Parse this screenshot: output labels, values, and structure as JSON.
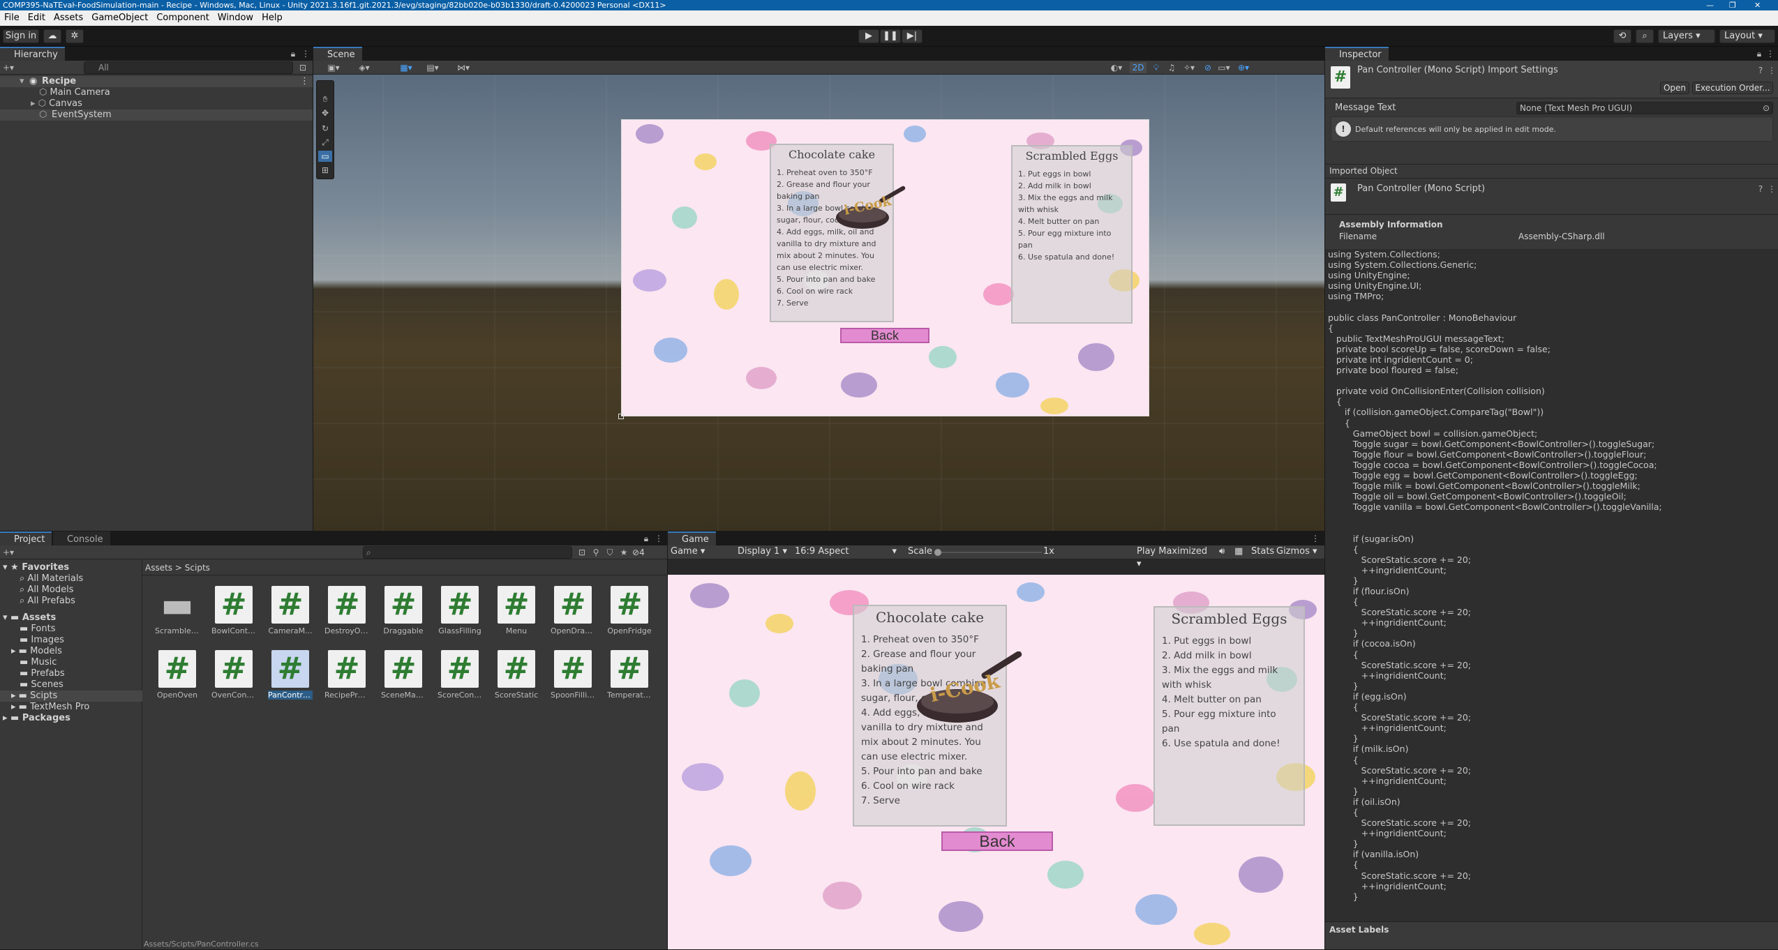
{
  "window": {
    "title": "COMP395-NaTEvaŀ-FoodSimulation-main - Recipe - Windows, Mac, Linux - Unity 2021.3.16f1.git.2021.3/evg/staging/82bb020e-b03b1330/draft-0.4200023 Personal <DX11>"
  },
  "menu": [
    "File",
    "Edit",
    "Assets",
    "GameObject",
    "Component",
    "Window",
    "Help"
  ],
  "toolbar": {
    "signin": "Sign in",
    "layers": "Layers",
    "layout": "Layout"
  },
  "hierarchy": {
    "tab": "Hierarchy",
    "search_placeholder": "All",
    "scene": "Recipe",
    "items": [
      "Main Camera",
      "Canvas",
      "EventSystem"
    ]
  },
  "scene": {
    "tab": "Scene",
    "mode2d": "2D"
  },
  "inspector": {
    "tab": "Inspector",
    "header_title": "Pan Controller (Mono Script) Import Settings",
    "open": "Open",
    "exec_order": "Execution Order...",
    "message_label": "Message Text",
    "message_value": "None (Text Mesh Pro UGUI)",
    "info": "Default references will only be applied in edit mode.",
    "imported_label": "Imported Object",
    "imported_title": "Pan Controller (Mono Script)",
    "assembly_heading": "Assembly Information",
    "filename_label": "Filename",
    "filename_value": "Assembly-CSharp.dll",
    "asset_labels": "Asset Labels"
  },
  "code": "using System.Collections;\nusing System.Collections.Generic;\nusing UnityEngine;\nusing UnityEngine.UI;\nusing TMPro;\n\npublic class PanController : MonoBehaviour\n{\n   public TextMeshProUGUI messageText;\n   private bool scoreUp = false, scoreDown = false;\n   private int ingridientCount = 0;\n   private bool floured = false;\n\n   private void OnCollisionEnter(Collision collision)\n   {\n      if (collision.gameObject.CompareTag(\"Bowl\"))\n      {\n         GameObject bowl = collision.gameObject;\n         Toggle sugar = bowl.GetComponent<BowlController>().toggleSugar;\n         Toggle flour = bowl.GetComponent<BowlController>().toggleFlour;\n         Toggle cocoa = bowl.GetComponent<BowlController>().toggleCocoa;\n         Toggle egg = bowl.GetComponent<BowlController>().toggleEgg;\n         Toggle milk = bowl.GetComponent<BowlController>().toggleMilk;\n         Toggle oil = bowl.GetComponent<BowlController>().toggleOil;\n         Toggle vanilla = bowl.GetComponent<BowlController>().toggleVanilla;\n\n\n         if (sugar.isOn)\n         {\n            ScoreStatic.score += 20;\n            ++ingridientCount;\n         }\n         if (flour.isOn)\n         {\n            ScoreStatic.score += 20;\n            ++ingridientCount;\n         }\n         if (cocoa.isOn)\n         {\n            ScoreStatic.score += 20;\n            ++ingridientCount;\n         }\n         if (egg.isOn)\n         {\n            ScoreStatic.score += 20;\n            ++ingridientCount;\n         }\n         if (milk.isOn)\n         {\n            ScoreStatic.score += 20;\n            ++ingridientCount;\n         }\n         if (oil.isOn)\n         {\n            ScoreStatic.score += 20;\n            ++ingridientCount;\n         }\n         if (vanilla.isOn)\n         {\n            ScoreStatic.score += 20;\n            ++ingridientCount;\n         }",
  "project": {
    "tab": "Project",
    "console_tab": "Console",
    "count": "4",
    "breadcrumb_root": "Assets",
    "breadcrumb_sep": ">",
    "breadcrumb_current": "Scipts",
    "favorites": "Favorites",
    "fav_items": [
      "All Materials",
      "All Models",
      "All Prefabs"
    ],
    "assets_label": "Assets",
    "folders": [
      "Fonts",
      "Images",
      "Models",
      "Music",
      "Prefabs",
      "Scenes",
      "Scipts",
      "TextMesh Pro"
    ],
    "packages": "Packages",
    "files_row1": [
      "Scrambled...",
      "BowlContro...",
      "CameraM...",
      "DestroyOb...",
      "Draggable",
      "GlassFilling",
      "Menu",
      "OpenDraw...",
      "OpenFridge"
    ],
    "files_row2": [
      "OpenOven",
      "OvenCont...",
      "PanControl...",
      "RecipeProg...",
      "SceneMan...",
      "ScoreCont...",
      "ScoreStatic",
      "SpoonFilling",
      "Temperatu..."
    ]
  },
  "game": {
    "tab": "Game",
    "display": "Game",
    "display1": "Display 1",
    "aspect": "16:9 Aspect",
    "scale_label": "Scale",
    "scale_value": "1x",
    "play_mode": "Play Maximized",
    "stats": "Stats",
    "gizmos": "Gizmos"
  },
  "recipe": {
    "cake_title": "Chocolate cake",
    "cake_steps": [
      "1. Preheat oven to 350°F",
      "2. Grease and flour your baking pan",
      "3. In a large bowl combine sugar, flour, cocoa, soda.",
      "4. Add eggs, milk, oil and vanilla to dry mixture and mix about 2 minutes. You can use electric mixer.",
      "5. Pour into pan and bake",
      "6. Cool on wire rack",
      "7. Serve"
    ],
    "eggs_title": "Scrambled Eggs",
    "eggs_steps": [
      "1. Put eggs in bowl",
      "2. Add milk in bowl",
      "3. Mix the eggs and milk with whisk",
      "4. Melt butter on pan",
      "5. Pour egg mixture into pan",
      "6. Use spatula and done!"
    ],
    "logo": "i-Cook",
    "back": "Back"
  },
  "status": {
    "path": "Assets/Scipts/PanController.cs"
  }
}
